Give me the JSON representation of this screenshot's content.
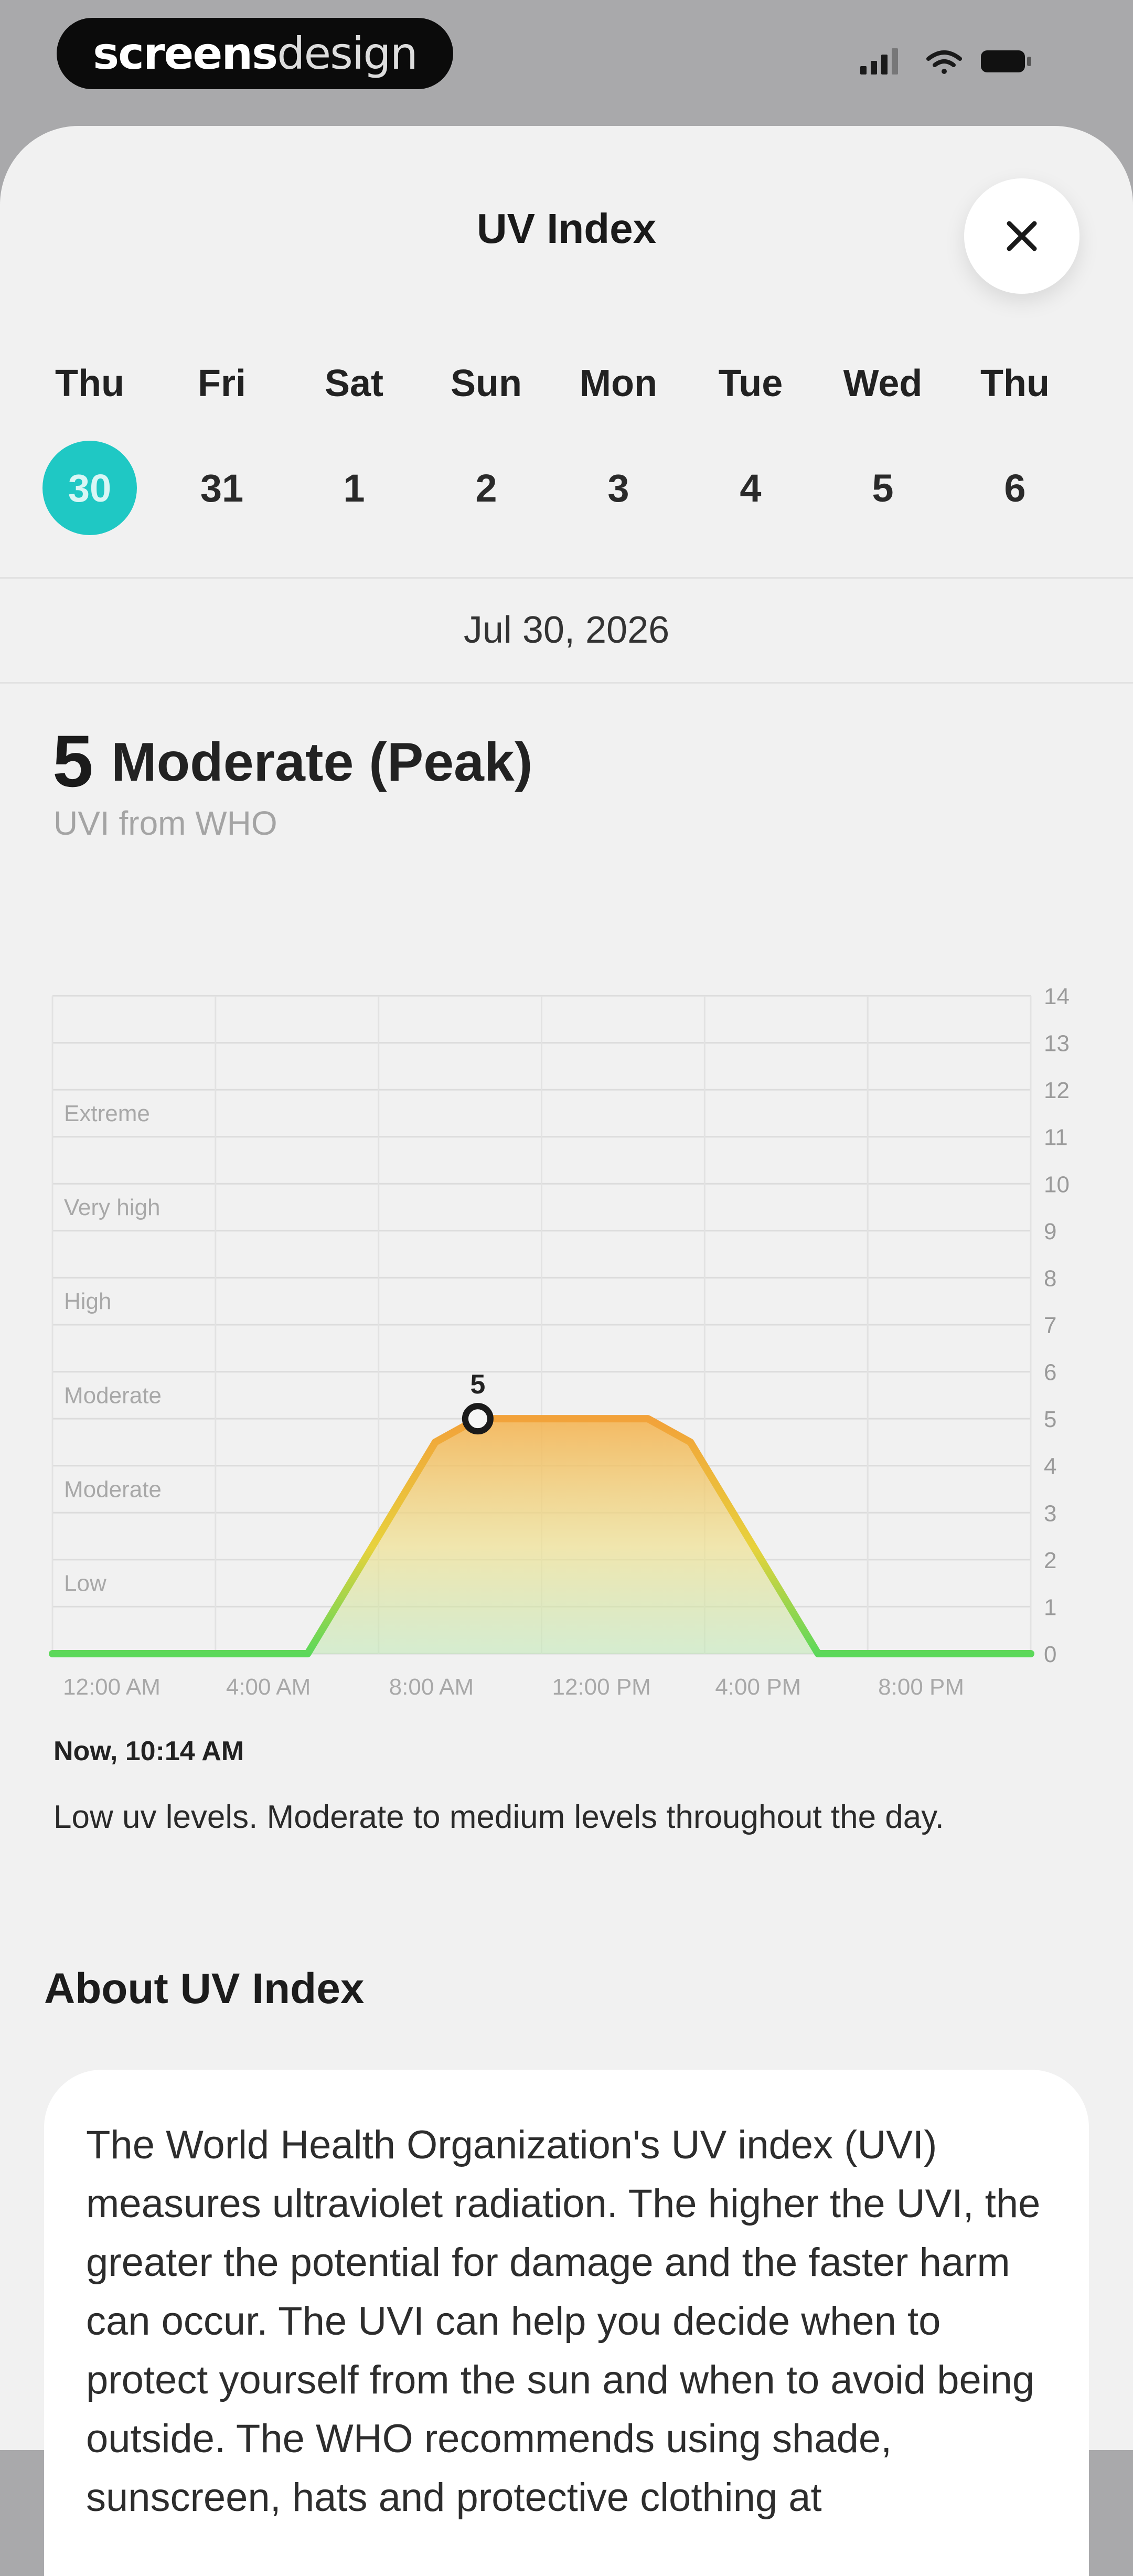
{
  "status_bar": {
    "brand_part1": "screens",
    "brand_part2": "design",
    "time": ""
  },
  "sheet": {
    "title": "UV Index",
    "close_icon": "close-icon"
  },
  "week": {
    "days": [
      {
        "name": "Thu",
        "date": "30",
        "selected": true
      },
      {
        "name": "Fri",
        "date": "31",
        "selected": false
      },
      {
        "name": "Sat",
        "date": "1",
        "selected": false
      },
      {
        "name": "Sun",
        "date": "2",
        "selected": false
      },
      {
        "name": "Mon",
        "date": "3",
        "selected": false
      },
      {
        "name": "Tue",
        "date": "4",
        "selected": false
      },
      {
        "name": "Wed",
        "date": "5",
        "selected": false
      },
      {
        "name": "Thu",
        "date": "6",
        "selected": false
      }
    ],
    "selected_color": "#1fc8c4"
  },
  "selected_date": "Jul 30, 2026",
  "summary": {
    "value": "5",
    "level": "Moderate (Peak)",
    "source": "UVI from WHO"
  },
  "chart_data": {
    "type": "area",
    "x_tick_labels": [
      "12:00 AM",
      "4:00 AM",
      "8:00 AM",
      "12:00 PM",
      "4:00 PM",
      "8:00 PM"
    ],
    "y_ticks": [
      0,
      1,
      2,
      3,
      4,
      5,
      6,
      7,
      8,
      9,
      10,
      11,
      12,
      13,
      14
    ],
    "ylim": [
      0,
      14
    ],
    "xlim": [
      0,
      23
    ],
    "band_labels": [
      {
        "label": "Extreme",
        "y": 11.5
      },
      {
        "label": "Very high",
        "y": 9.5
      },
      {
        "label": "High",
        "y": 7.5
      },
      {
        "label": "Moderate",
        "y": 5.5
      },
      {
        "label": "Moderate",
        "y": 3.5
      },
      {
        "label": "Low",
        "y": 1.5
      }
    ],
    "series": [
      {
        "x": [
          0,
          1,
          2,
          3,
          4,
          5,
          6,
          7,
          8,
          9,
          10,
          11,
          12,
          13,
          14,
          15,
          16,
          17,
          18,
          19,
          20,
          21,
          22,
          23
        ],
        "values": [
          0,
          0,
          0,
          0,
          0,
          0,
          0,
          1.5,
          3,
          4.5,
          5,
          5,
          5,
          5,
          5,
          4.5,
          3,
          1.5,
          0,
          0,
          0,
          0,
          0,
          0
        ]
      }
    ],
    "marker": {
      "x": 10,
      "y": 5,
      "label": "5"
    },
    "grid": true,
    "colors": {
      "low": "#5cd85a",
      "moderate": "#f0d040",
      "high": "#f2a23a"
    }
  },
  "now": {
    "label": "Now, 10:14 AM",
    "description": "Low uv levels. Moderate to medium levels throughout the day."
  },
  "about": {
    "title": "About UV Index",
    "text": "The World Health Organization's UV index (UVI) measures ultraviolet radiation. The higher the UVI, the greater the potential for damage and the faster harm can occur. The UVI can help you decide when to protect yourself from the sun and when to avoid being outside. The WHO recommends using shade, sunscreen, hats and protective clothing at"
  }
}
